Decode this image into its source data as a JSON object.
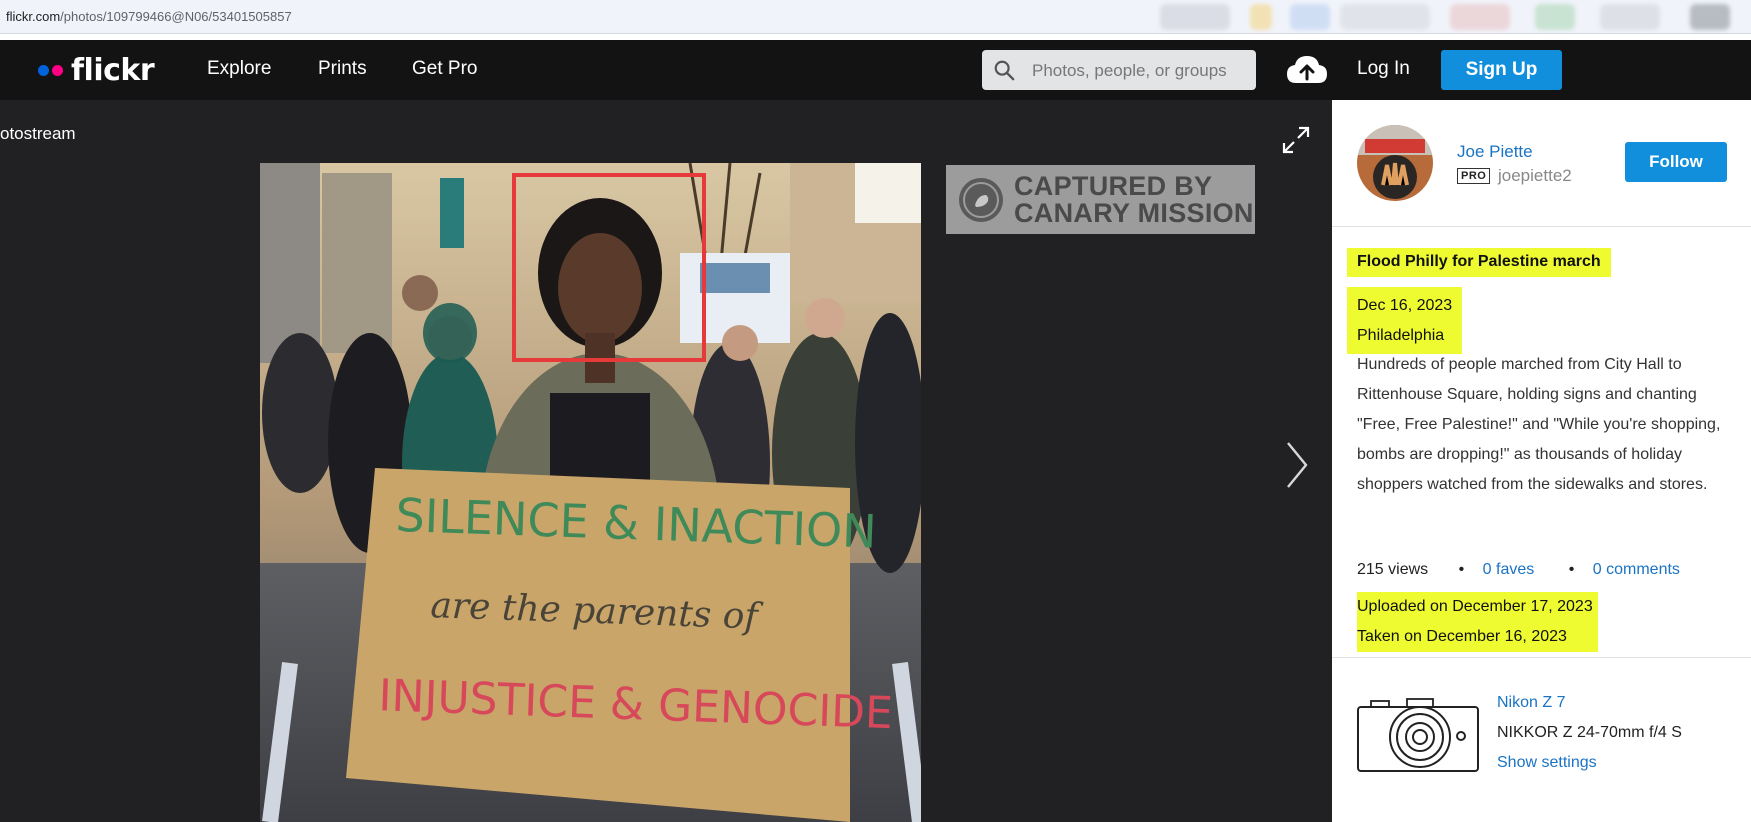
{
  "browser": {
    "url_host": "flickr.com",
    "url_path": "/photos/109799466@N06/53401505857"
  },
  "header": {
    "logo": "flickr",
    "nav": [
      "Explore",
      "Prints",
      "Get Pro"
    ],
    "search_placeholder": "Photos, people, or groups",
    "login": "Log In",
    "signup": "Sign Up"
  },
  "photo_view": {
    "back_label": "otostream",
    "watermark_line1": "CAPTURED BY",
    "watermark_line2": "CANARY MISSION",
    "sign_line1": "SILENCE & INACTION",
    "sign_line2": "are the parents of",
    "sign_line3": "INJUSTICE & GENOCIDE"
  },
  "owner": {
    "name": "Joe Piette",
    "pro_badge": "PRO",
    "username": "joepiette2",
    "follow_label": "Follow"
  },
  "details": {
    "title": "Flood Philly for Palestine march",
    "date": "Dec 16, 2023",
    "location": "Philadelphia",
    "description": "Hundreds of people marched from City Hall to Rittenhouse Square, holding signs and chanting \"Free, Free Palestine!\" and \"While you're shopping, bombs are dropping!\" as thousands of holiday shoppers watched from the sidewalks and stores.",
    "views": "215 views",
    "faves": "0 faves",
    "comments": "0 comments",
    "uploaded": "Uploaded on December 17, 2023",
    "taken": "Taken on December 16, 2023"
  },
  "exif": {
    "camera": "Nikon Z 7",
    "lens": "NIKKOR Z 24-70mm f/4 S",
    "settings_link": "Show settings"
  },
  "colors": {
    "flickr_blue": "#0063dc",
    "flickr_pink": "#ff0084",
    "button_blue": "#128fdc",
    "highlight": "#eefb31"
  }
}
